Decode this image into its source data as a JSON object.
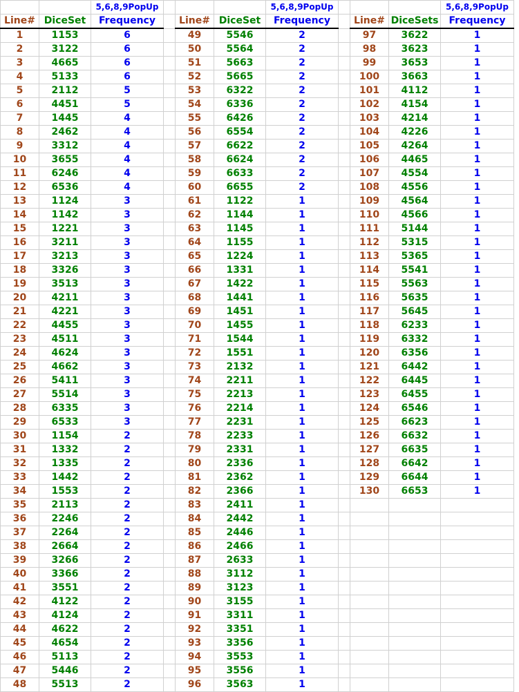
{
  "colors": {
    "line": "#a0461a",
    "dice": "#008000",
    "freq": "#0000ee",
    "grid": "#d0d0d0"
  },
  "blocks": [
    {
      "top_header": "5,6,8,9PopUp",
      "headers": [
        "Line#",
        "DiceSet",
        "Frequency"
      ],
      "rows": [
        [
          "1",
          "1153",
          "6"
        ],
        [
          "2",
          "3122",
          "6"
        ],
        [
          "3",
          "4665",
          "6"
        ],
        [
          "4",
          "5133",
          "6"
        ],
        [
          "5",
          "2112",
          "5"
        ],
        [
          "6",
          "4451",
          "5"
        ],
        [
          "7",
          "1445",
          "4"
        ],
        [
          "8",
          "2462",
          "4"
        ],
        [
          "9",
          "3312",
          "4"
        ],
        [
          "10",
          "3655",
          "4"
        ],
        [
          "11",
          "6246",
          "4"
        ],
        [
          "12",
          "6536",
          "4"
        ],
        [
          "13",
          "1124",
          "3"
        ],
        [
          "14",
          "1142",
          "3"
        ],
        [
          "15",
          "1221",
          "3"
        ],
        [
          "16",
          "3211",
          "3"
        ],
        [
          "17",
          "3213",
          "3"
        ],
        [
          "18",
          "3326",
          "3"
        ],
        [
          "19",
          "3513",
          "3"
        ],
        [
          "20",
          "4211",
          "3"
        ],
        [
          "21",
          "4221",
          "3"
        ],
        [
          "22",
          "4455",
          "3"
        ],
        [
          "23",
          "4511",
          "3"
        ],
        [
          "24",
          "4624",
          "3"
        ],
        [
          "25",
          "4662",
          "3"
        ],
        [
          "26",
          "5411",
          "3"
        ],
        [
          "27",
          "5514",
          "3"
        ],
        [
          "28",
          "6335",
          "3"
        ],
        [
          "29",
          "6533",
          "3"
        ],
        [
          "30",
          "1154",
          "2"
        ],
        [
          "31",
          "1332",
          "2"
        ],
        [
          "32",
          "1335",
          "2"
        ],
        [
          "33",
          "1442",
          "2"
        ],
        [
          "34",
          "1553",
          "2"
        ],
        [
          "35",
          "2113",
          "2"
        ],
        [
          "36",
          "2246",
          "2"
        ],
        [
          "37",
          "2264",
          "2"
        ],
        [
          "38",
          "2664",
          "2"
        ],
        [
          "39",
          "3266",
          "2"
        ],
        [
          "40",
          "3366",
          "2"
        ],
        [
          "41",
          "3551",
          "2"
        ],
        [
          "42",
          "4122",
          "2"
        ],
        [
          "43",
          "4124",
          "2"
        ],
        [
          "44",
          "4622",
          "2"
        ],
        [
          "45",
          "4654",
          "2"
        ],
        [
          "46",
          "5113",
          "2"
        ],
        [
          "47",
          "5446",
          "2"
        ],
        [
          "48",
          "5513",
          "2"
        ]
      ]
    },
    {
      "top_header": "5,6,8,9PopUp",
      "headers": [
        "Line#",
        "DiceSet",
        "Frequency"
      ],
      "rows": [
        [
          "49",
          "5546",
          "2"
        ],
        [
          "50",
          "5564",
          "2"
        ],
        [
          "51",
          "5663",
          "2"
        ],
        [
          "52",
          "5665",
          "2"
        ],
        [
          "53",
          "6322",
          "2"
        ],
        [
          "54",
          "6336",
          "2"
        ],
        [
          "55",
          "6426",
          "2"
        ],
        [
          "56",
          "6554",
          "2"
        ],
        [
          "57",
          "6622",
          "2"
        ],
        [
          "58",
          "6624",
          "2"
        ],
        [
          "59",
          "6633",
          "2"
        ],
        [
          "60",
          "6655",
          "2"
        ],
        [
          "61",
          "1122",
          "1"
        ],
        [
          "62",
          "1144",
          "1"
        ],
        [
          "63",
          "1145",
          "1"
        ],
        [
          "64",
          "1155",
          "1"
        ],
        [
          "65",
          "1224",
          "1"
        ],
        [
          "66",
          "1331",
          "1"
        ],
        [
          "67",
          "1422",
          "1"
        ],
        [
          "68",
          "1441",
          "1"
        ],
        [
          "69",
          "1451",
          "1"
        ],
        [
          "70",
          "1455",
          "1"
        ],
        [
          "71",
          "1544",
          "1"
        ],
        [
          "72",
          "1551",
          "1"
        ],
        [
          "73",
          "2132",
          "1"
        ],
        [
          "74",
          "2211",
          "1"
        ],
        [
          "75",
          "2213",
          "1"
        ],
        [
          "76",
          "2214",
          "1"
        ],
        [
          "77",
          "2231",
          "1"
        ],
        [
          "78",
          "2233",
          "1"
        ],
        [
          "79",
          "2331",
          "1"
        ],
        [
          "80",
          "2336",
          "1"
        ],
        [
          "81",
          "2362",
          "1"
        ],
        [
          "82",
          "2366",
          "1"
        ],
        [
          "83",
          "2411",
          "1"
        ],
        [
          "84",
          "2442",
          "1"
        ],
        [
          "85",
          "2446",
          "1"
        ],
        [
          "86",
          "2466",
          "1"
        ],
        [
          "87",
          "2633",
          "1"
        ],
        [
          "88",
          "3112",
          "1"
        ],
        [
          "89",
          "3123",
          "1"
        ],
        [
          "90",
          "3155",
          "1"
        ],
        [
          "91",
          "3311",
          "1"
        ],
        [
          "92",
          "3351",
          "1"
        ],
        [
          "93",
          "3356",
          "1"
        ],
        [
          "94",
          "3553",
          "1"
        ],
        [
          "95",
          "3556",
          "1"
        ],
        [
          "96",
          "3563",
          "1"
        ]
      ]
    },
    {
      "top_header": "5,6,8,9PopUp",
      "headers": [
        "Line#",
        "DiceSets",
        "Frequency"
      ],
      "rows": [
        [
          "97",
          "3622",
          "1"
        ],
        [
          "98",
          "3623",
          "1"
        ],
        [
          "99",
          "3653",
          "1"
        ],
        [
          "100",
          "3663",
          "1"
        ],
        [
          "101",
          "4112",
          "1"
        ],
        [
          "102",
          "4154",
          "1"
        ],
        [
          "103",
          "4214",
          "1"
        ],
        [
          "104",
          "4226",
          "1"
        ],
        [
          "105",
          "4264",
          "1"
        ],
        [
          "106",
          "4465",
          "1"
        ],
        [
          "107",
          "4554",
          "1"
        ],
        [
          "108",
          "4556",
          "1"
        ],
        [
          "109",
          "4564",
          "1"
        ],
        [
          "110",
          "4566",
          "1"
        ],
        [
          "111",
          "5144",
          "1"
        ],
        [
          "112",
          "5315",
          "1"
        ],
        [
          "113",
          "5365",
          "1"
        ],
        [
          "114",
          "5541",
          "1"
        ],
        [
          "115",
          "5563",
          "1"
        ],
        [
          "116",
          "5635",
          "1"
        ],
        [
          "117",
          "5645",
          "1"
        ],
        [
          "118",
          "6233",
          "1"
        ],
        [
          "119",
          "6332",
          "1"
        ],
        [
          "120",
          "6356",
          "1"
        ],
        [
          "121",
          "6442",
          "1"
        ],
        [
          "122",
          "6445",
          "1"
        ],
        [
          "123",
          "6455",
          "1"
        ],
        [
          "124",
          "6546",
          "1"
        ],
        [
          "125",
          "6623",
          "1"
        ],
        [
          "126",
          "6632",
          "1"
        ],
        [
          "127",
          "6635",
          "1"
        ],
        [
          "128",
          "6642",
          "1"
        ],
        [
          "129",
          "6644",
          "1"
        ],
        [
          "130",
          "6653",
          "1"
        ]
      ]
    }
  ]
}
